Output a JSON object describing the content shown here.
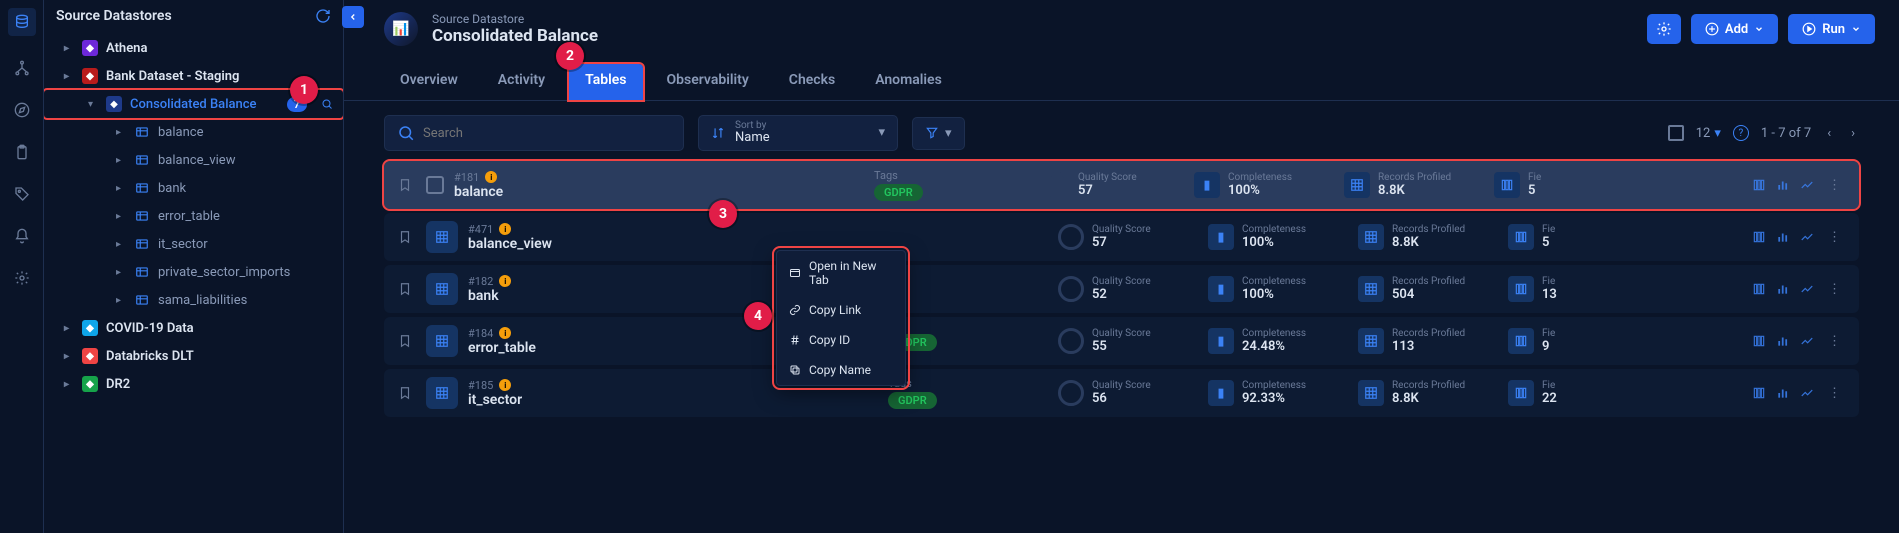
{
  "icon_rail": [
    "database",
    "hierarchy",
    "compass",
    "clipboard",
    "tag",
    "bell",
    "gear"
  ],
  "tree": {
    "title": "Source Datastores",
    "items": [
      {
        "label": "Athena",
        "icon": "athena",
        "icon_bg": "#6d28d9",
        "level": 1,
        "expand": ">"
      },
      {
        "label": "Bank Dataset - Staging",
        "icon": "bank",
        "icon_bg": "#b91c1c",
        "level": 1,
        "expand": ">"
      },
      {
        "label": "Consolidated Balance",
        "icon": "cb",
        "icon_bg": "#1e3a8a",
        "level": 2,
        "expand": "v",
        "selected": true,
        "badge": "7",
        "outlined": true,
        "search": true
      },
      {
        "label": "balance",
        "icon": "table",
        "level": 3,
        "expand": ">"
      },
      {
        "label": "balance_view",
        "icon": "table",
        "level": 3,
        "expand": ">"
      },
      {
        "label": "bank",
        "icon": "table",
        "level": 3,
        "expand": ">"
      },
      {
        "label": "error_table",
        "icon": "table",
        "level": 3,
        "expand": ">"
      },
      {
        "label": "it_sector",
        "icon": "table",
        "level": 3,
        "expand": ">"
      },
      {
        "label": "private_sector_imports",
        "icon": "table",
        "level": 3,
        "expand": ">"
      },
      {
        "label": "sama_liabilities",
        "icon": "table",
        "level": 3,
        "expand": ">"
      },
      {
        "label": "COVID-19 Data",
        "icon": "covid",
        "icon_bg": "#0ea5e9",
        "level": 1,
        "expand": ">"
      },
      {
        "label": "Databricks DLT",
        "icon": "databricks",
        "icon_bg": "#ef4444",
        "level": 1,
        "expand": ">"
      },
      {
        "label": "DR2",
        "icon": "db2",
        "icon_bg": "#16a34a",
        "level": 1,
        "expand": ">"
      }
    ]
  },
  "header": {
    "breadcrumb": "Source Datastore",
    "title": "Consolidated Balance",
    "actions": {
      "settings": "",
      "add_label": "Add",
      "run_label": "Run"
    }
  },
  "tabs": [
    "Overview",
    "Activity",
    "Tables",
    "Observability",
    "Checks",
    "Anomalies"
  ],
  "active_tab": "Tables",
  "toolbar": {
    "search_placeholder": "Search",
    "sort_label": "Sort by",
    "sort_value": "Name",
    "page_size": "12",
    "page_info": "1 - 7 of 7"
  },
  "columns": {
    "tags": "Tags",
    "quality": "Quality Score",
    "completeness": "Completeness",
    "records": "Records Profiled",
    "fie": "Fie"
  },
  "rows": [
    {
      "id": "#181",
      "name": "balance",
      "tag": "GDPR",
      "show_tag": true,
      "quality": "57",
      "completeness": "100%",
      "records": "8.8K",
      "fie": "5",
      "hover": true,
      "outlined": true,
      "checkbox": true
    },
    {
      "id": "#471",
      "name": "balance_view",
      "tag": "",
      "show_tag": false,
      "quality": "57",
      "completeness": "100%",
      "records": "8.8K",
      "fie": "5"
    },
    {
      "id": "#182",
      "name": "bank",
      "tag": "",
      "show_tag": false,
      "quality": "52",
      "completeness": "100%",
      "records": "504",
      "fie": "13"
    },
    {
      "id": "#184",
      "name": "error_table",
      "tag": "GDPR",
      "show_tag": true,
      "hide_label": true,
      "quality": "55",
      "completeness": "24.48%",
      "records": "113",
      "fie": "9"
    },
    {
      "id": "#185",
      "name": "it_sector",
      "tag": "GDPR",
      "show_tag": true,
      "quality": "56",
      "completeness": "92.33%",
      "records": "8.8K",
      "fie": "22"
    }
  ],
  "context_menu": {
    "items": [
      {
        "icon": "open",
        "label": "Open in New Tab"
      },
      {
        "icon": "link",
        "label": "Copy Link"
      },
      {
        "icon": "hash",
        "label": "Copy ID"
      },
      {
        "icon": "copy",
        "label": "Copy Name"
      }
    ]
  },
  "markers": {
    "1": "1",
    "2": "2",
    "3": "3",
    "4": "4"
  }
}
